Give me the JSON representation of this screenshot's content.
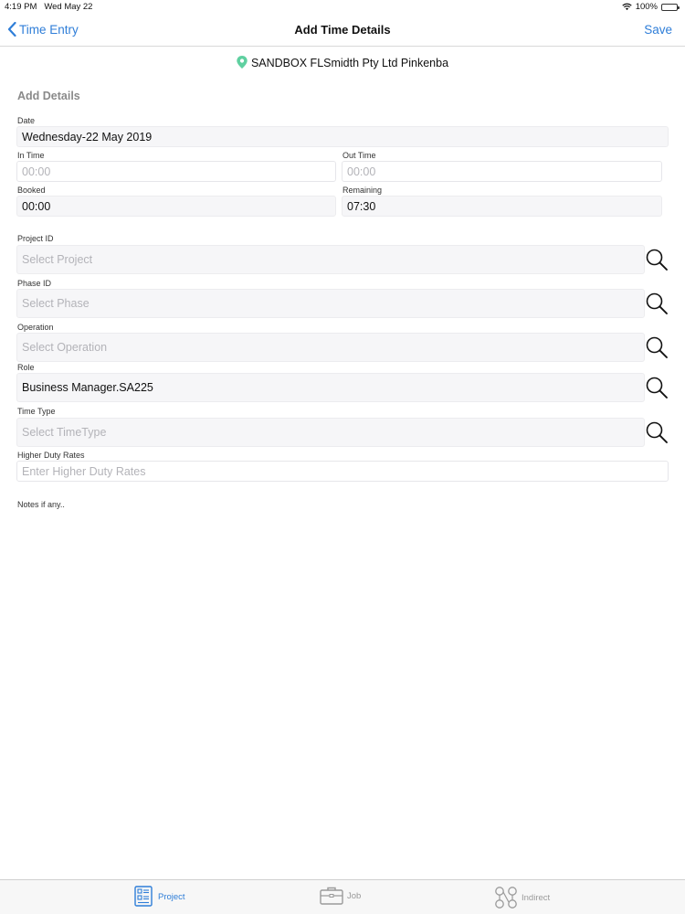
{
  "status_bar": {
    "time": "4:19 PM",
    "date": "Wed May 22",
    "battery": "100%",
    "battery_level": 1.0
  },
  "nav": {
    "back_label": "Time Entry",
    "title": "Add Time Details",
    "save_label": "Save"
  },
  "location": {
    "name": "SANDBOX FLSmidth Pty Ltd Pinkenba",
    "pin_color": "#5fd0a0"
  },
  "form": {
    "section_title": "Add Details",
    "date": {
      "label": "Date",
      "value": "Wednesday-22 May 2019"
    },
    "in_time": {
      "label": "In Time",
      "placeholder": "00:00"
    },
    "out_time": {
      "label": "Out Time",
      "placeholder": "00:00"
    },
    "booked": {
      "label": "Booked",
      "value": "00:00"
    },
    "remaining": {
      "label": "Remaining",
      "value": "07:30"
    },
    "project_id": {
      "label": "Project ID",
      "placeholder": "Select Project"
    },
    "phase_id": {
      "label": "Phase ID",
      "placeholder": "Select Phase"
    },
    "operation": {
      "label": "Operation",
      "placeholder": "Select Operation"
    },
    "role": {
      "label": "Role",
      "value": "Business Manager.SA225"
    },
    "time_type": {
      "label": "Time Type",
      "placeholder": "Select TimeType"
    },
    "higher_duty_rates": {
      "label": "Higher Duty Rates",
      "placeholder": "Enter Higher Duty Rates"
    },
    "notes_label": "Notes if any.."
  },
  "tab_bar": {
    "tabs": [
      {
        "label": "Project",
        "icon": "project-icon",
        "active": true
      },
      {
        "label": "Job",
        "icon": "briefcase-icon",
        "active": false
      },
      {
        "label": "Indirect",
        "icon": "indirect-icon",
        "active": false
      }
    ]
  },
  "colors": {
    "accent": "#2f7ed8",
    "placeholder": "#b3b3b8",
    "field_bg": "#f6f6f8"
  }
}
